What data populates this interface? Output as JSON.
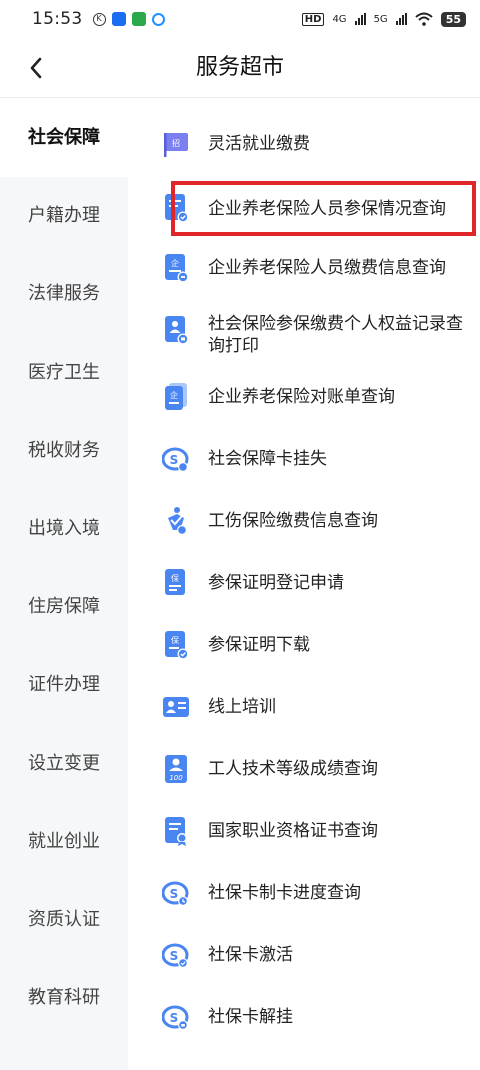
{
  "status_bar": {
    "time": "15:53",
    "network_1": "4G",
    "network_2": "5G",
    "hd_label": "HD",
    "battery": "55"
  },
  "header": {
    "title": "服务超市"
  },
  "sidebar": {
    "items": [
      {
        "label": "社会保障",
        "active": true
      },
      {
        "label": "户籍办理"
      },
      {
        "label": "法律服务"
      },
      {
        "label": "医疗卫生"
      },
      {
        "label": "税收财务"
      },
      {
        "label": "出境入境"
      },
      {
        "label": "住房保障"
      },
      {
        "label": "证件办理"
      },
      {
        "label": "设立变更"
      },
      {
        "label": "就业创业"
      },
      {
        "label": "资质认证"
      },
      {
        "label": "教育科研"
      }
    ]
  },
  "services": {
    "items": [
      {
        "label": "灵活就业缴费",
        "icon": "flag-icon"
      },
      {
        "label": "企业养老保险人员参保情况查询",
        "icon": "document-check-icon"
      },
      {
        "label": "企业养老保险人员缴费信息查询",
        "icon": "document-enterprise-icon"
      },
      {
        "label": "社会保险参保缴费个人权益记录查询打印",
        "icon": "person-document-icon"
      },
      {
        "label": "企业养老保险对账单查询",
        "icon": "statement-icon"
      },
      {
        "label": "社会保障卡挂失",
        "icon": "social-security-card-icon"
      },
      {
        "label": "工伤保险缴费信息查询",
        "icon": "injury-insurance-icon"
      },
      {
        "label": "参保证明登记申请",
        "icon": "insurance-certificate-icon"
      },
      {
        "label": "参保证明下载",
        "icon": "certificate-download-icon"
      },
      {
        "label": "线上培训",
        "icon": "online-training-icon"
      },
      {
        "label": "工人技术等级成绩查询",
        "icon": "worker-grade-icon"
      },
      {
        "label": "国家职业资格证书查询",
        "icon": "qualification-certificate-icon"
      },
      {
        "label": "社保卡制卡进度查询",
        "icon": "card-progress-icon"
      },
      {
        "label": "社保卡激活",
        "icon": "card-activate-icon"
      },
      {
        "label": "社保卡解挂",
        "icon": "card-unlock-icon"
      }
    ]
  },
  "icon_glyphs": {
    "flag": "招",
    "enterprise": "企",
    "insure": "保"
  },
  "colors": {
    "accent_blue": "#3a7ef0",
    "highlight_red": "#e0262b",
    "sidebar_bg": "#f6f7f9"
  }
}
